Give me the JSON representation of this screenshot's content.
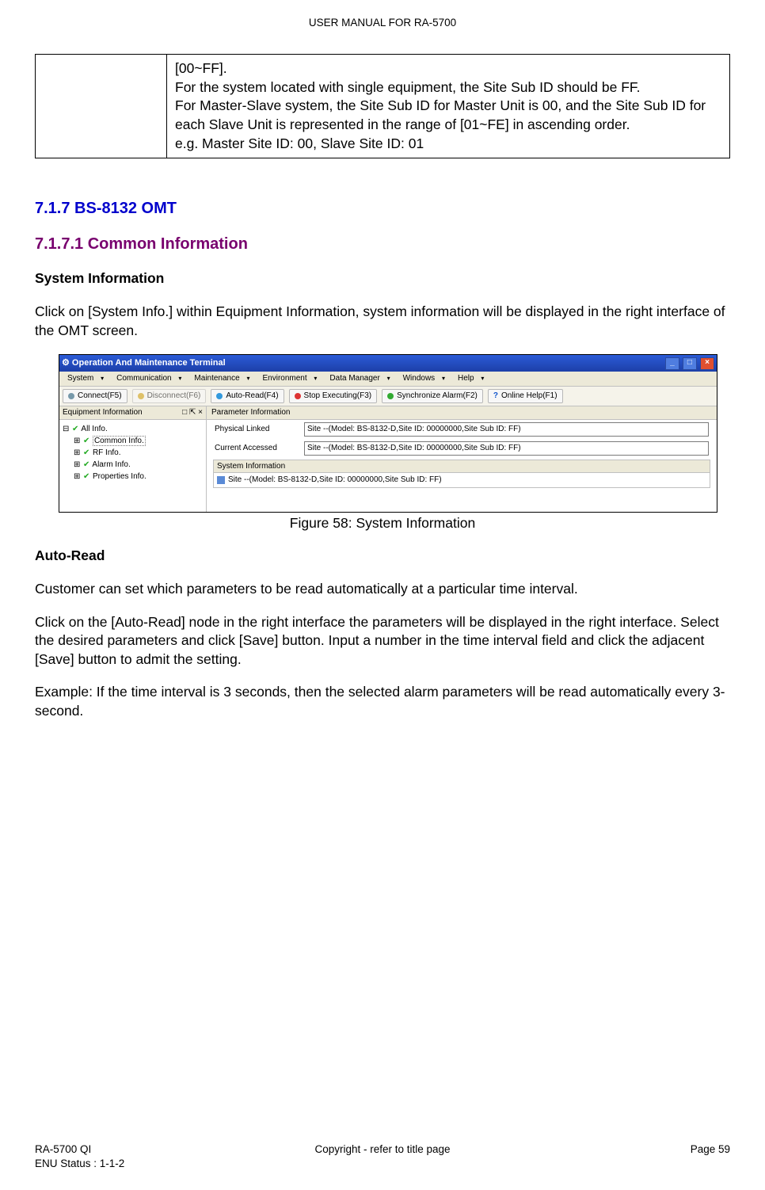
{
  "header": "USER MANUAL FOR RA-5700",
  "box": {
    "text": "[00~FF].\nFor the system located with single equipment, the Site Sub ID should be FF.\nFor Master-Slave system, the Site Sub ID for Master Unit is 00, and the Site Sub ID for each Slave Unit is represented in the range of [01~FE] in ascending order.\ne.g. Master Site ID: 00, Slave Site ID: 01"
  },
  "h1": "7.1.7   BS-8132 OMT",
  "h2": "7.1.7.1 Common Information",
  "h3a": "System Information",
  "p1": "Click on [System Info.] within Equipment Information, system information will be displayed in the right interface of the OMT screen.",
  "shot": {
    "title": "Operation And Maintenance Terminal",
    "menu": [
      "System",
      "Communication",
      "Maintenance",
      "Environment",
      "Data Manager",
      "Windows",
      "Help"
    ],
    "toolbar": {
      "connect": "Connect(F5)",
      "disconnect": "Disconnect(F6)",
      "autoread": "Auto-Read(F4)",
      "stop": "Stop Executing(F3)",
      "sync": "Synchronize Alarm(F2)",
      "help": "Online Help(F1)"
    },
    "left_title": "Equipment Information",
    "pin_controls": "□ ⇱ ×",
    "tree": {
      "root": "All Info.",
      "n1": "Common Info.",
      "n2": "RF Info.",
      "n3": "Alarm Info.",
      "n4": "Properties Info."
    },
    "right_title": "Parameter Information",
    "physical_label": "Physical Linked",
    "physical_value": "Site --(Model: BS-8132-D,Site ID: 00000000,Site Sub ID: FF)",
    "current_label": "Current Accessed",
    "current_value": "Site --(Model: BS-8132-D,Site ID: 00000000,Site Sub ID: FF)",
    "sysinfo_hd": "System Information",
    "sysinfo_row": "Site --(Model: BS-8132-D,Site ID: 00000000,Site Sub ID: FF)"
  },
  "caption": "Figure 58: System Information",
  "h3b": "Auto-Read",
  "p2": "Customer can set which parameters to be read automatically at a particular time interval.",
  "p3": "Click on the [Auto-Read] node in the right interface the parameters will be displayed in the right interface. Select the desired parameters and click [Save] button. Input a number in the time interval field and click the adjacent [Save] button to admit the setting.",
  "p4": "Example: If the time interval is 3 seconds, then the selected alarm parameters will be read automatically every 3-second.",
  "footer": {
    "l1": "RA-5700 QI",
    "l2": "ENU Status : 1-1-2",
    "mid": "Copyright - refer to title page",
    "right": "Page 59"
  }
}
